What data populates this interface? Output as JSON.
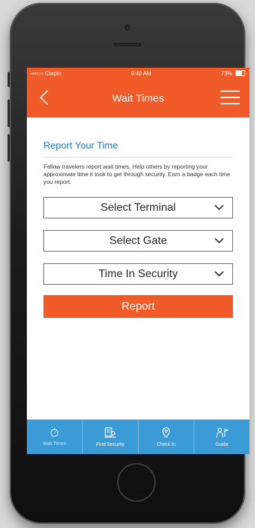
{
  "status_bar": {
    "carrier": "•••○○ Corpin",
    "time": "9:40 AM",
    "battery": "73%"
  },
  "nav": {
    "title": "Wait Times",
    "back_icon": "chevron-left-icon",
    "menu_icon": "hamburger-menu-icon"
  },
  "report": {
    "title": "Report Your Time",
    "description": "Fellow travelers report wait times. Help others by reporting your approximate time it took to get through security. Earn a badge each time you report."
  },
  "selects": [
    {
      "label": "Select Terminal",
      "icon": "chevron-down-icon"
    },
    {
      "label": "Select Gate",
      "icon": "chevron-down-icon"
    },
    {
      "label": "Time In Security",
      "icon": "chevron-down-icon"
    }
  ],
  "report_button": "Report",
  "tabs": [
    {
      "label": "Wait Times",
      "icon": "stopwatch-icon",
      "active": true
    },
    {
      "label": "Find Security",
      "icon": "security-checkpoint-icon"
    },
    {
      "label": "Check In",
      "icon": "location-pin-icon"
    },
    {
      "label": "Guide",
      "icon": "guide-icon"
    }
  ],
  "colors": {
    "accent": "#f15a29",
    "tab_bar": "#3b9bd6",
    "title_blue": "#2876b9"
  }
}
